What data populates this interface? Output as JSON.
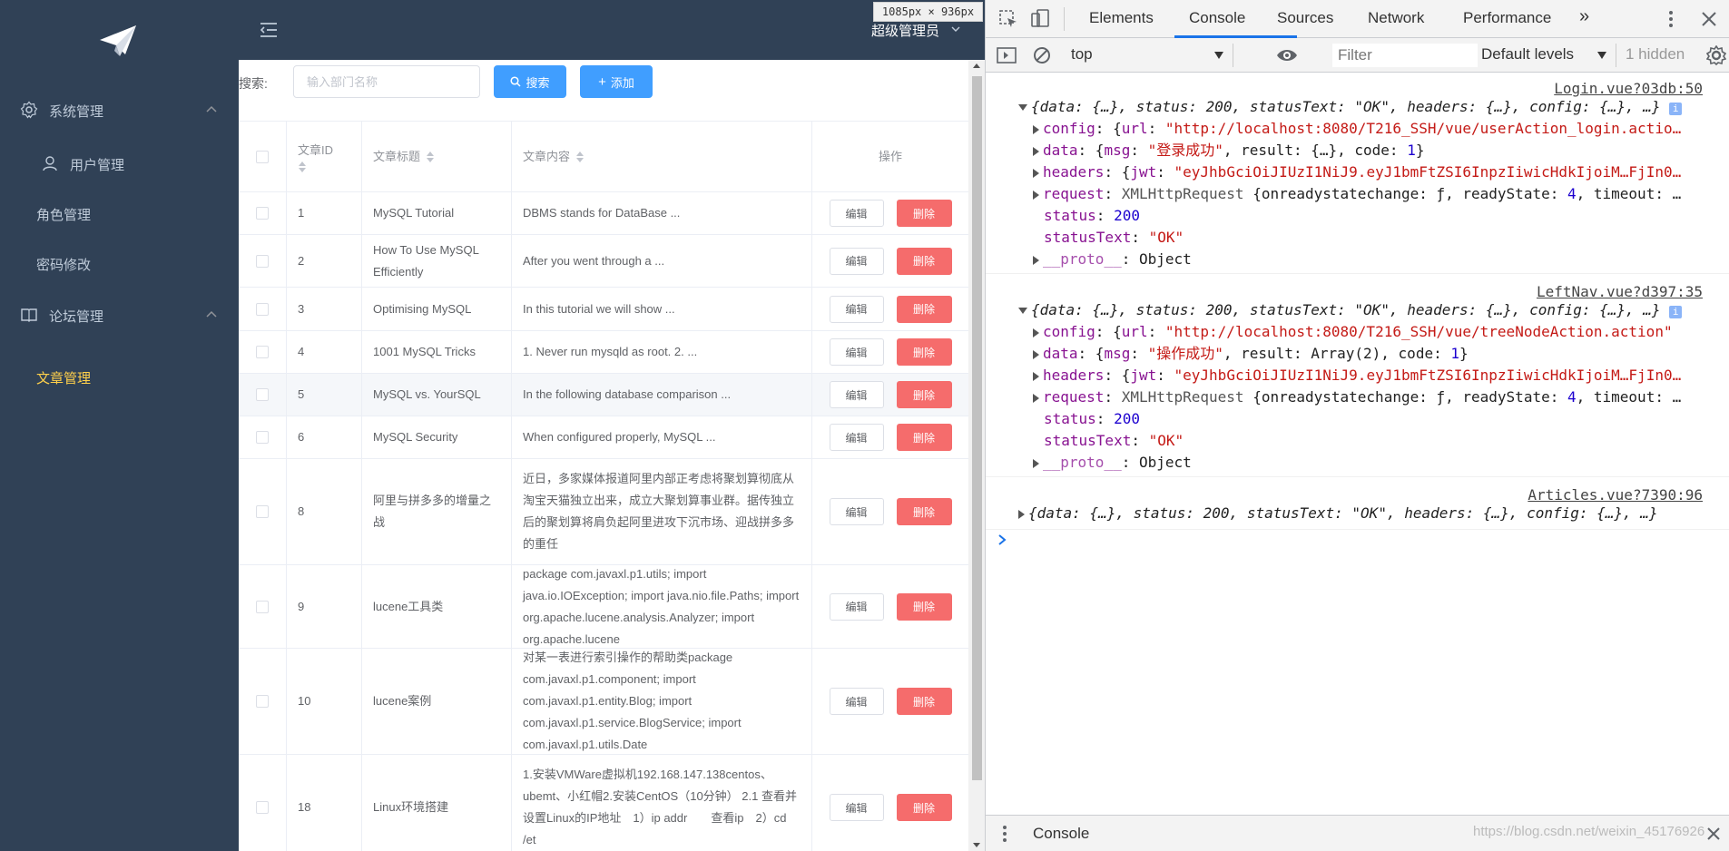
{
  "sidebar": {
    "logo_icon": "paper-plane-icon",
    "groups": [
      {
        "label": "系统管理",
        "icon": "gear-icon"
      },
      {
        "label": "论坛管理",
        "icon": "book-icon"
      }
    ],
    "items": [
      {
        "label": "用户管理",
        "icon": "user-icon"
      },
      {
        "label": "角色管理"
      },
      {
        "label": "密码修改"
      },
      {
        "label": "文章管理",
        "active": true
      }
    ],
    "active_color": "#ffd04b",
    "bg_color": "#304156"
  },
  "header": {
    "toggle_icon": "menu-fold-icon",
    "user_label": "超级管理员",
    "size_tip": "1085px × 936px"
  },
  "search": {
    "label": "搜索:",
    "placeholder": "输入部门名称",
    "search_btn": "搜索",
    "add_btn": "添加"
  },
  "table": {
    "columns": {
      "id": "文章ID",
      "title": "文章标题",
      "content": "文章内容",
      "actions": "操作"
    },
    "edit_label": "编辑",
    "delete_label": "删除",
    "rows": [
      {
        "id": "1",
        "title": "MySQL Tutorial",
        "content": "DBMS stands for DataBase ..."
      },
      {
        "id": "2",
        "title": "How To Use MySQL Efficiently",
        "content": "After you went through a ..."
      },
      {
        "id": "3",
        "title": "Optimising MySQL",
        "content": "In this tutorial we will show ..."
      },
      {
        "id": "4",
        "title": "1001 MySQL Tricks",
        "content": "1. Never run mysqld as root. 2. ..."
      },
      {
        "id": "5",
        "title": "MySQL vs. YourSQL",
        "content": "In the following database comparison ..."
      },
      {
        "id": "6",
        "title": "MySQL Security",
        "content": "When configured properly, MySQL ..."
      },
      {
        "id": "8",
        "title": "阿里与拼多多的增量之战",
        "content": "近日，多家媒体报道阿里内部正考虑将聚划算彻底从淘宝天猫独立出来，成立大聚划算事业群。据传独立后的聚划算将肩负起阿里进攻下沉市场、迎战拼多多的重任"
      },
      {
        "id": "9",
        "title": "lucene工具类",
        "content": "package com.javaxl.p1.utils; import java.io.IOException; import java.nio.file.Paths; import org.apache.lucene.analysis.Analyzer; import org.apache.lucene"
      },
      {
        "id": "10",
        "title": "lucene案例",
        "content": "对某一表进行索引操作的帮助类package com.javaxl.p1.component; import com.javaxl.p1.entity.Blog; import com.javaxl.p1.service.BlogService; import com.javaxl.p1.utils.Date"
      },
      {
        "id": "18",
        "title": "Linux环境搭建",
        "content": "1.安装VMWare虚拟机192.168.147.138centos、ubemt、小红帽2.安装CentOS（10分钟） 2.1 查看并设置Linux的IP地址　1）ip addr　　查看ip　2）cd /et"
      }
    ]
  },
  "devtools": {
    "tabs": [
      "Elements",
      "Console",
      "Sources",
      "Network",
      "Performance"
    ],
    "more_tabs": "»",
    "context": "top",
    "filter_placeholder": "Filter",
    "levels": "Default levels",
    "hidden": "1 hidden",
    "drawer_tab": "Console",
    "watermark": "https://blog.csdn.net/weixin_45176926",
    "messages": [
      {
        "source": "Login.vue?03db:50",
        "summary": "{data: {…}, status: 200, statusText: \"OK\", headers: {…}, config: {…}, …}",
        "config_url": "\"http://localhost:8080/T216_SSH/vue/userAction_login.actio…",
        "data_msg": "\"登录成功\"",
        "data_rest": ", result: {…}, code: ",
        "code": "1",
        "jwt": "\"eyJhbGciOiJIUzI1NiJ9.eyJ1bmFtZSI6InpzIiwicHdkIjoiM…FjIn0…",
        "request_tail": " {onreadystatechange: ƒ, readyState: ",
        "readyState": "4",
        "request_end": ", timeout: …",
        "status": "200",
        "statusText": "\"OK\"",
        "proto": "Object"
      },
      {
        "source": "LeftNav.vue?d397:35",
        "summary": "{data: {…}, status: 200, statusText: \"OK\", headers: {…}, config: {…}, …}",
        "config_url": "\"http://localhost:8080/T216_SSH/vue/treeNodeAction.action\"",
        "data_msg": "\"操作成功\"",
        "data_rest": ", result: Array(2), code: ",
        "code": "1",
        "jwt": "\"eyJhbGciOiJIUzI1NiJ9.eyJ1bmFtZSI6InpzIiwicHdkIjoiM…FjIn0…",
        "request_tail": " {onreadystatechange: ƒ, readyState: ",
        "readyState": "4",
        "request_end": ", timeout: …",
        "status": "200",
        "statusText": "\"OK\"",
        "proto": "Object"
      },
      {
        "source": "Articles.vue?7390:96",
        "summary": "{data: {…}, status: 200, statusText: \"OK\", headers: {…}, config: {…}, …}"
      }
    ]
  }
}
